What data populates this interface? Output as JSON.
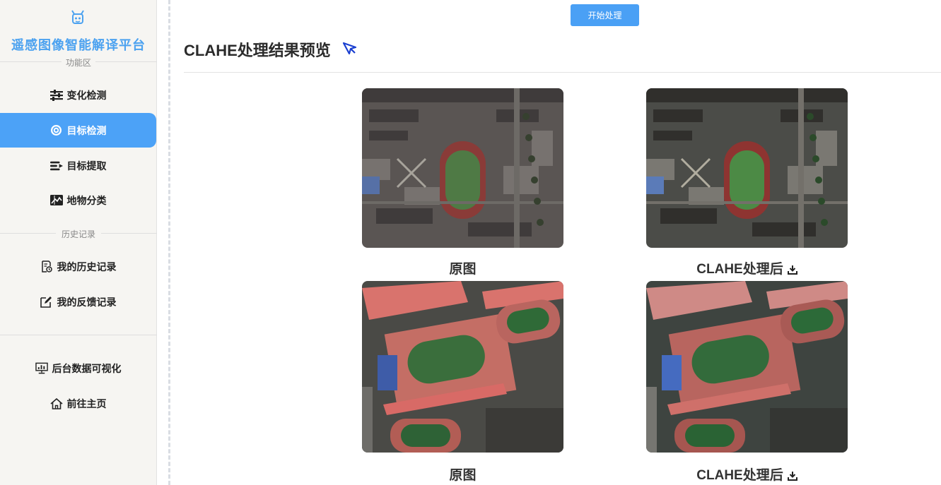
{
  "sidebar": {
    "brand": "遥感图像智能解译平台",
    "section_function": "功能区",
    "section_history": "历史记录",
    "items": [
      {
        "label": "变化检测",
        "icon": "sliders-icon",
        "active": false
      },
      {
        "label": "目标检测",
        "icon": "target-icon",
        "active": true
      },
      {
        "label": "目标提取",
        "icon": "extract-icon",
        "active": false
      },
      {
        "label": "地物分类",
        "icon": "map-icon",
        "active": false
      }
    ],
    "history_items": [
      {
        "label": "我的历史记录",
        "icon": "history-doc-icon"
      },
      {
        "label": "我的反馈记录",
        "icon": "edit-icon"
      }
    ],
    "bottom_items": [
      {
        "label": "后台数据可视化",
        "icon": "monitor-chart-icon"
      },
      {
        "label": "前往主页",
        "icon": "home-icon"
      }
    ]
  },
  "main": {
    "start_button": "开始处理",
    "title": "CLAHE处理结果预览",
    "rows": [
      {
        "original_caption": "原图",
        "processed_caption": "CLAHE处理后"
      },
      {
        "original_caption": "原图",
        "processed_caption": "CLAHE处理后"
      }
    ]
  },
  "colors": {
    "accent": "#4ca2f7",
    "brand_text": "#4ca2f0",
    "sidebar_bg": "#f6f5f2"
  }
}
